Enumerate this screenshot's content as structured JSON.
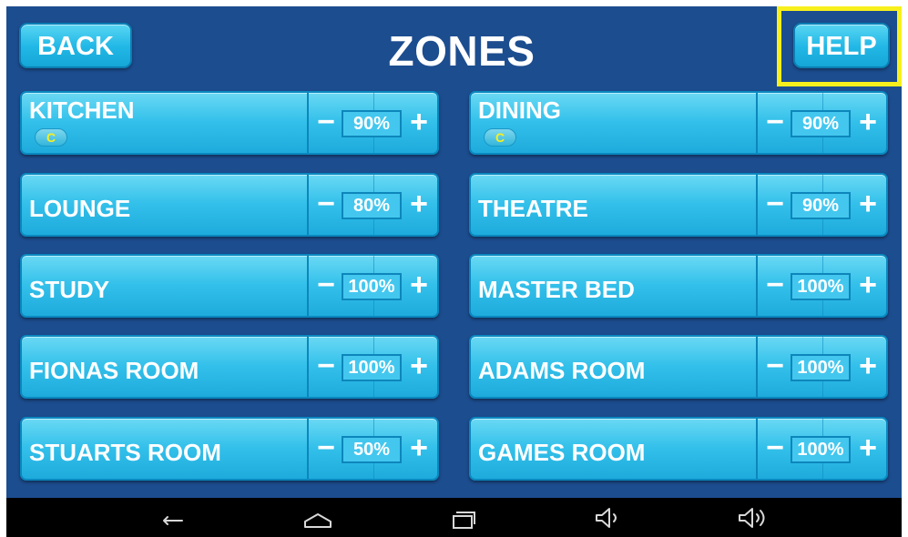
{
  "header": {
    "back_label": "BACK",
    "title": "ZONES",
    "help_label": "HELP"
  },
  "controls": {
    "minus": "−",
    "plus": "+"
  },
  "zones": [
    {
      "name": "KITCHEN",
      "volume": "90%",
      "badge": "C"
    },
    {
      "name": "DINING",
      "volume": "90%",
      "badge": "C"
    },
    {
      "name": "LOUNGE",
      "volume": "80%"
    },
    {
      "name": "THEATRE",
      "volume": "90%"
    },
    {
      "name": "STUDY",
      "volume": "100%"
    },
    {
      "name": "MASTER BED",
      "volume": "100%"
    },
    {
      "name": "FIONAS ROOM",
      "volume": "100%"
    },
    {
      "name": "ADAMS ROOM",
      "volume": "100%"
    },
    {
      "name": "STUARTS ROOM",
      "volume": "50%"
    },
    {
      "name": "GAMES ROOM",
      "volume": "100%"
    }
  ],
  "nav_bar": {
    "icons": [
      "back-icon",
      "home-icon",
      "recent-apps-icon",
      "volume-down-icon",
      "volume-up-icon"
    ]
  },
  "colors": {
    "background": "#1c4d8f",
    "button": "#22b8e6",
    "highlight": "#f7f01d",
    "badge_text": "#f7f01d"
  }
}
